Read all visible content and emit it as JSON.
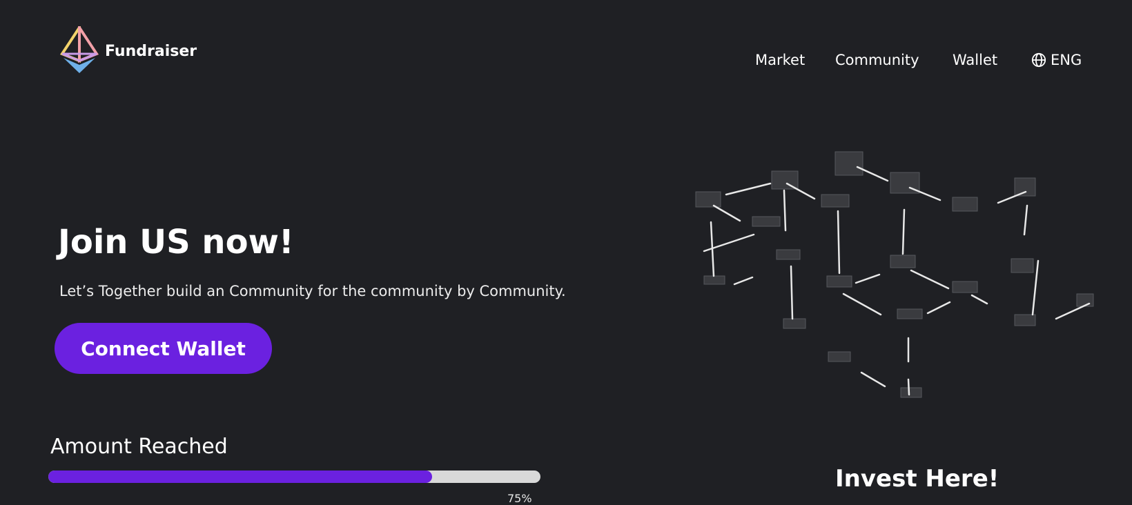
{
  "brand": {
    "name": "Fundraiser",
    "logo": "ethereum-diamond-logo"
  },
  "nav": {
    "items": [
      {
        "label": "Market"
      },
      {
        "label": "Community"
      },
      {
        "label": "Wallet"
      }
    ],
    "language": {
      "label": "ENG",
      "icon": "globe-icon"
    }
  },
  "hero": {
    "title": "Join US now!",
    "subtitle": "Let’s Together build an Community for the community by Community.",
    "cta_label": "Connect Wallet"
  },
  "progress": {
    "label": "Amount Reached",
    "percent_text": "75%",
    "fill_fraction": 0.78
  },
  "invest": {
    "title": "Invest Here!"
  },
  "colors": {
    "background": "#1f2024",
    "accent": "#6b21e0",
    "track": "#d9d9d9",
    "text": "#ffffff"
  }
}
